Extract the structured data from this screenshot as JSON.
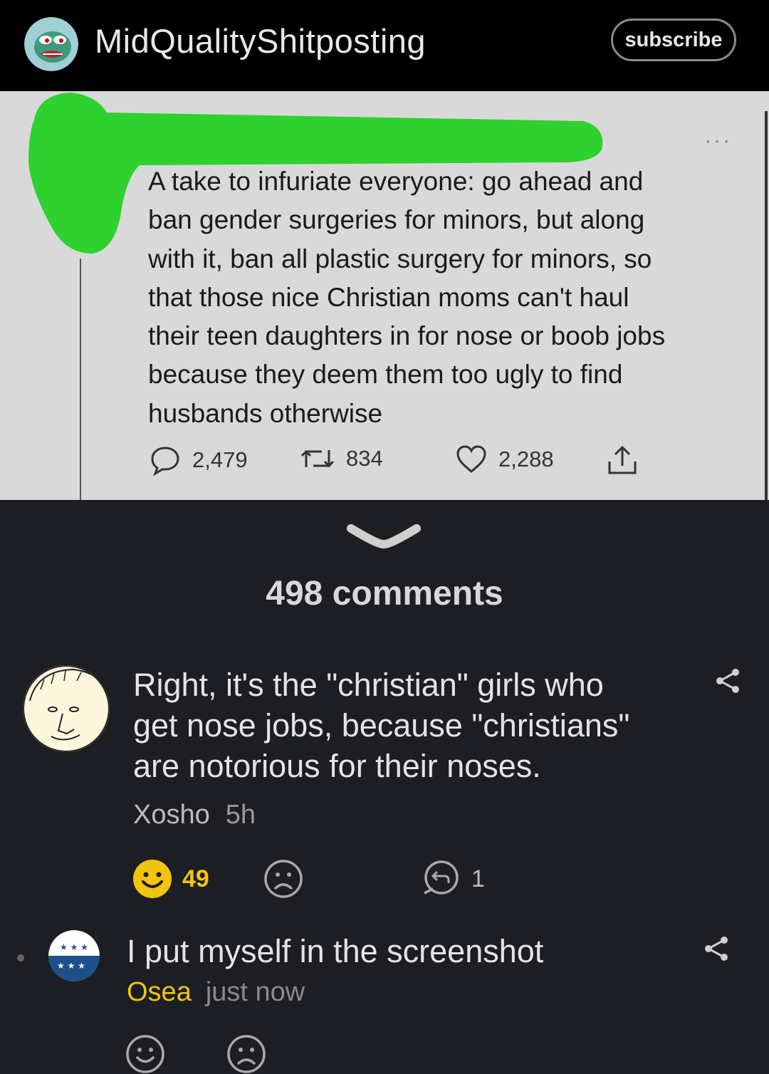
{
  "header": {
    "community_name": "MidQualityShitposting",
    "subscribe_label": "subscribe",
    "avatar_icon": "pepe-avatar-icon"
  },
  "post": {
    "tweet_lines": [
      "A take to infuriate everyone: go ahead and",
      "ban gender surgeries for minors, but along",
      "with it, ban all plastic surgery for minors, so",
      "that those nice Christian moms can't haul",
      "their teen daughters in for nose or boob jobs",
      "because they deem them too ugly to find",
      "husbands otherwise"
    ],
    "replies": "2,479",
    "retweets": "834",
    "likes": "2,288",
    "redaction_color": "#2ed12e"
  },
  "comments_header": "498 comments",
  "comments": [
    {
      "lines": [
        "Right, it's the \"christian\" girls who",
        "get nose jobs, because \"christians\"",
        "are notorious for their noses."
      ],
      "user": "Xosho",
      "time": "5h",
      "upvotes": "49",
      "replies": "1"
    },
    {
      "text": "I put myself in the screenshot",
      "user": "Osea",
      "time": "just now"
    }
  ],
  "colors": {
    "background": "#1d1e23",
    "header": "#000000",
    "accent_yellow": "#f1c40f"
  }
}
